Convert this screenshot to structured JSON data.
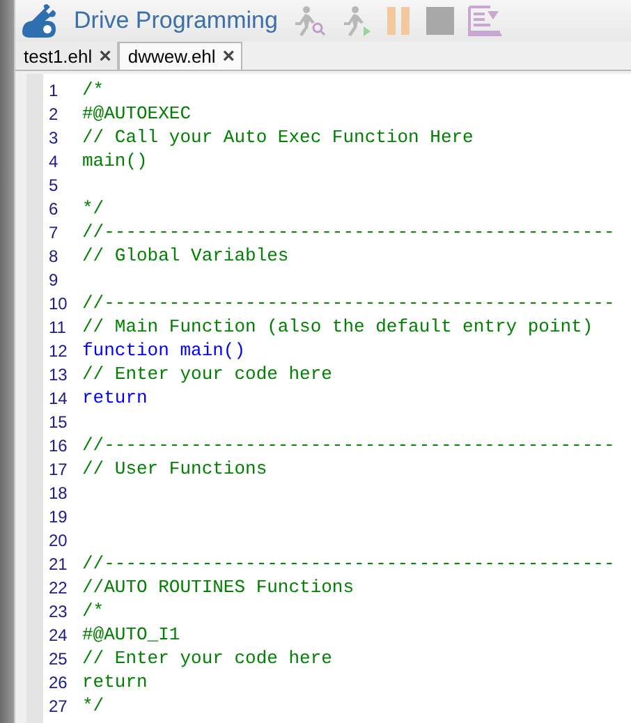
{
  "title": "Drive Programming",
  "tabs": [
    {
      "label": "test1.ehl",
      "close": "×",
      "selected": false
    },
    {
      "label": "dwwew.ehl",
      "close": "×",
      "selected": true
    }
  ],
  "lines": [
    {
      "number": "1",
      "kind": "comment",
      "text": "/*"
    },
    {
      "number": "2",
      "kind": "comment",
      "text": "#@AUTOEXEC"
    },
    {
      "number": "3",
      "kind": "comment",
      "text": "// Call your Auto Exec Function Here"
    },
    {
      "number": "4",
      "kind": "comment",
      "text": "main()"
    },
    {
      "number": "5"
    },
    {
      "number": "6",
      "kind": "comment",
      "text": "*/"
    },
    {
      "number": "7",
      "kind": "comment",
      "text": "//-----------------------------------------------"
    },
    {
      "number": "8",
      "kind": "comment",
      "text": "// Global Variables"
    },
    {
      "number": "9"
    },
    {
      "number": "10",
      "kind": "comment",
      "text": "//-----------------------------------------------"
    },
    {
      "number": "11",
      "kind": "comment",
      "text": "// Main Function (also the default entry point)"
    },
    {
      "number": "12",
      "kind": "keyword",
      "text": "function main()"
    },
    {
      "number": "13",
      "kind": "comment",
      "text": "// Enter your code here"
    },
    {
      "number": "14",
      "kind": "keyword",
      "text": "return"
    },
    {
      "number": "15"
    },
    {
      "number": "16",
      "kind": "comment",
      "text": "//-----------------------------------------------"
    },
    {
      "number": "17",
      "kind": "comment",
      "text": "// User Functions"
    },
    {
      "number": "18"
    },
    {
      "number": "19"
    },
    {
      "number": "20"
    },
    {
      "number": "21",
      "kind": "comment",
      "text": "//-----------------------------------------------"
    },
    {
      "number": "22",
      "kind": "comment",
      "text": "//AUTO ROUTINES Functions"
    },
    {
      "number": "23",
      "kind": "comment",
      "text": "/*"
    },
    {
      "number": "24",
      "kind": "comment",
      "text": "#@AUTO_I1"
    },
    {
      "number": "25",
      "kind": "comment",
      "text": "// Enter your code here"
    },
    {
      "number": "26",
      "kind": "comment",
      "text": "return"
    },
    {
      "number": "27",
      "kind": "comment",
      "text": "*/"
    }
  ]
}
